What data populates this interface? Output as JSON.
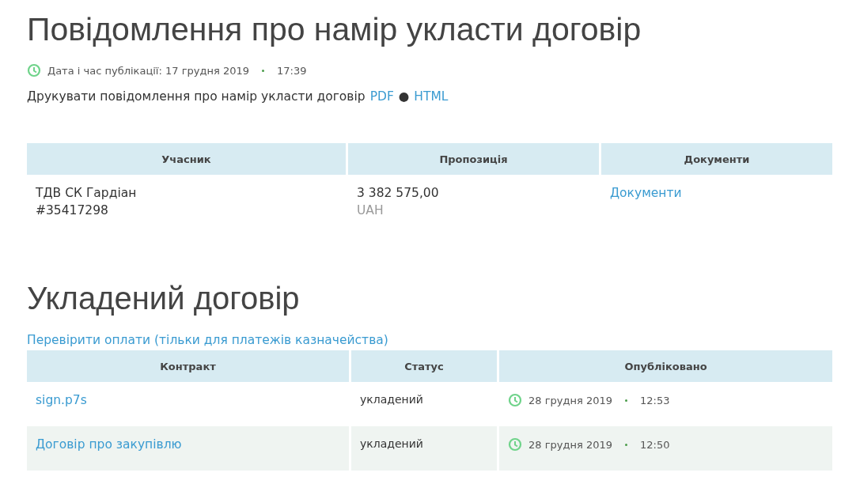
{
  "notice": {
    "title": "Повідомлення про намір укласти договір",
    "published_label": "Дата і час публікації: 17 грудня 2019",
    "published_time": "17:39",
    "print_text": "Друкувати повідомлення про намір укласти договір",
    "print_links": [
      "PDF",
      "HTML"
    ],
    "separator": "●"
  },
  "bids_table": {
    "columns": [
      "Учасник",
      "Пропозиція",
      "Документи"
    ],
    "rows": [
      {
        "participant": "ТДВ СК Гардіан",
        "code": "#35417298",
        "amount": "3 382 575,00",
        "currency": "UAH",
        "documents": "Документи"
      }
    ]
  },
  "contract": {
    "title": "Укладений договір",
    "check_link": "Перевірити оплати (тільки для платежів казначейства)",
    "columns": [
      "Контракт",
      "Статус",
      "Опубліковано"
    ],
    "rows": [
      {
        "file": "sign.p7s",
        "status": "укладений",
        "date": "28 грудня 2019",
        "time": "12:53"
      },
      {
        "file": "Договір про закупівлю",
        "status": "укладений",
        "date": "28 грудня 2019",
        "time": "12:50"
      }
    ]
  }
}
